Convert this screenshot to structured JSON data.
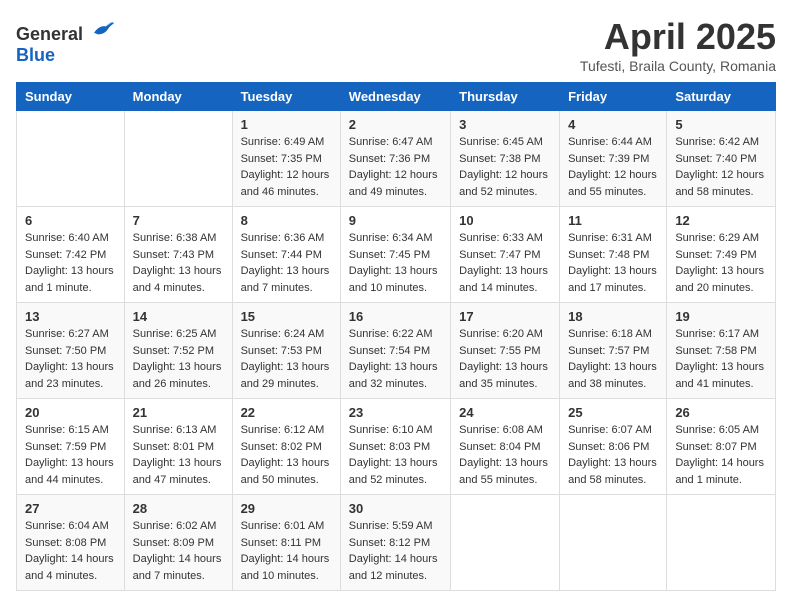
{
  "header": {
    "logo_general": "General",
    "logo_blue": "Blue",
    "month_title": "April 2025",
    "subtitle": "Tufesti, Braila County, Romania"
  },
  "days_of_week": [
    "Sunday",
    "Monday",
    "Tuesday",
    "Wednesday",
    "Thursday",
    "Friday",
    "Saturday"
  ],
  "weeks": [
    [
      {
        "day": "",
        "content": ""
      },
      {
        "day": "",
        "content": ""
      },
      {
        "day": "1",
        "content": "Sunrise: 6:49 AM\nSunset: 7:35 PM\nDaylight: 12 hours and 46 minutes."
      },
      {
        "day": "2",
        "content": "Sunrise: 6:47 AM\nSunset: 7:36 PM\nDaylight: 12 hours and 49 minutes."
      },
      {
        "day": "3",
        "content": "Sunrise: 6:45 AM\nSunset: 7:38 PM\nDaylight: 12 hours and 52 minutes."
      },
      {
        "day": "4",
        "content": "Sunrise: 6:44 AM\nSunset: 7:39 PM\nDaylight: 12 hours and 55 minutes."
      },
      {
        "day": "5",
        "content": "Sunrise: 6:42 AM\nSunset: 7:40 PM\nDaylight: 12 hours and 58 minutes."
      }
    ],
    [
      {
        "day": "6",
        "content": "Sunrise: 6:40 AM\nSunset: 7:42 PM\nDaylight: 13 hours and 1 minute."
      },
      {
        "day": "7",
        "content": "Sunrise: 6:38 AM\nSunset: 7:43 PM\nDaylight: 13 hours and 4 minutes."
      },
      {
        "day": "8",
        "content": "Sunrise: 6:36 AM\nSunset: 7:44 PM\nDaylight: 13 hours and 7 minutes."
      },
      {
        "day": "9",
        "content": "Sunrise: 6:34 AM\nSunset: 7:45 PM\nDaylight: 13 hours and 10 minutes."
      },
      {
        "day": "10",
        "content": "Sunrise: 6:33 AM\nSunset: 7:47 PM\nDaylight: 13 hours and 14 minutes."
      },
      {
        "day": "11",
        "content": "Sunrise: 6:31 AM\nSunset: 7:48 PM\nDaylight: 13 hours and 17 minutes."
      },
      {
        "day": "12",
        "content": "Sunrise: 6:29 AM\nSunset: 7:49 PM\nDaylight: 13 hours and 20 minutes."
      }
    ],
    [
      {
        "day": "13",
        "content": "Sunrise: 6:27 AM\nSunset: 7:50 PM\nDaylight: 13 hours and 23 minutes."
      },
      {
        "day": "14",
        "content": "Sunrise: 6:25 AM\nSunset: 7:52 PM\nDaylight: 13 hours and 26 minutes."
      },
      {
        "day": "15",
        "content": "Sunrise: 6:24 AM\nSunset: 7:53 PM\nDaylight: 13 hours and 29 minutes."
      },
      {
        "day": "16",
        "content": "Sunrise: 6:22 AM\nSunset: 7:54 PM\nDaylight: 13 hours and 32 minutes."
      },
      {
        "day": "17",
        "content": "Sunrise: 6:20 AM\nSunset: 7:55 PM\nDaylight: 13 hours and 35 minutes."
      },
      {
        "day": "18",
        "content": "Sunrise: 6:18 AM\nSunset: 7:57 PM\nDaylight: 13 hours and 38 minutes."
      },
      {
        "day": "19",
        "content": "Sunrise: 6:17 AM\nSunset: 7:58 PM\nDaylight: 13 hours and 41 minutes."
      }
    ],
    [
      {
        "day": "20",
        "content": "Sunrise: 6:15 AM\nSunset: 7:59 PM\nDaylight: 13 hours and 44 minutes."
      },
      {
        "day": "21",
        "content": "Sunrise: 6:13 AM\nSunset: 8:01 PM\nDaylight: 13 hours and 47 minutes."
      },
      {
        "day": "22",
        "content": "Sunrise: 6:12 AM\nSunset: 8:02 PM\nDaylight: 13 hours and 50 minutes."
      },
      {
        "day": "23",
        "content": "Sunrise: 6:10 AM\nSunset: 8:03 PM\nDaylight: 13 hours and 52 minutes."
      },
      {
        "day": "24",
        "content": "Sunrise: 6:08 AM\nSunset: 8:04 PM\nDaylight: 13 hours and 55 minutes."
      },
      {
        "day": "25",
        "content": "Sunrise: 6:07 AM\nSunset: 8:06 PM\nDaylight: 13 hours and 58 minutes."
      },
      {
        "day": "26",
        "content": "Sunrise: 6:05 AM\nSunset: 8:07 PM\nDaylight: 14 hours and 1 minute."
      }
    ],
    [
      {
        "day": "27",
        "content": "Sunrise: 6:04 AM\nSunset: 8:08 PM\nDaylight: 14 hours and 4 minutes."
      },
      {
        "day": "28",
        "content": "Sunrise: 6:02 AM\nSunset: 8:09 PM\nDaylight: 14 hours and 7 minutes."
      },
      {
        "day": "29",
        "content": "Sunrise: 6:01 AM\nSunset: 8:11 PM\nDaylight: 14 hours and 10 minutes."
      },
      {
        "day": "30",
        "content": "Sunrise: 5:59 AM\nSunset: 8:12 PM\nDaylight: 14 hours and 12 minutes."
      },
      {
        "day": "",
        "content": ""
      },
      {
        "day": "",
        "content": ""
      },
      {
        "day": "",
        "content": ""
      }
    ]
  ]
}
